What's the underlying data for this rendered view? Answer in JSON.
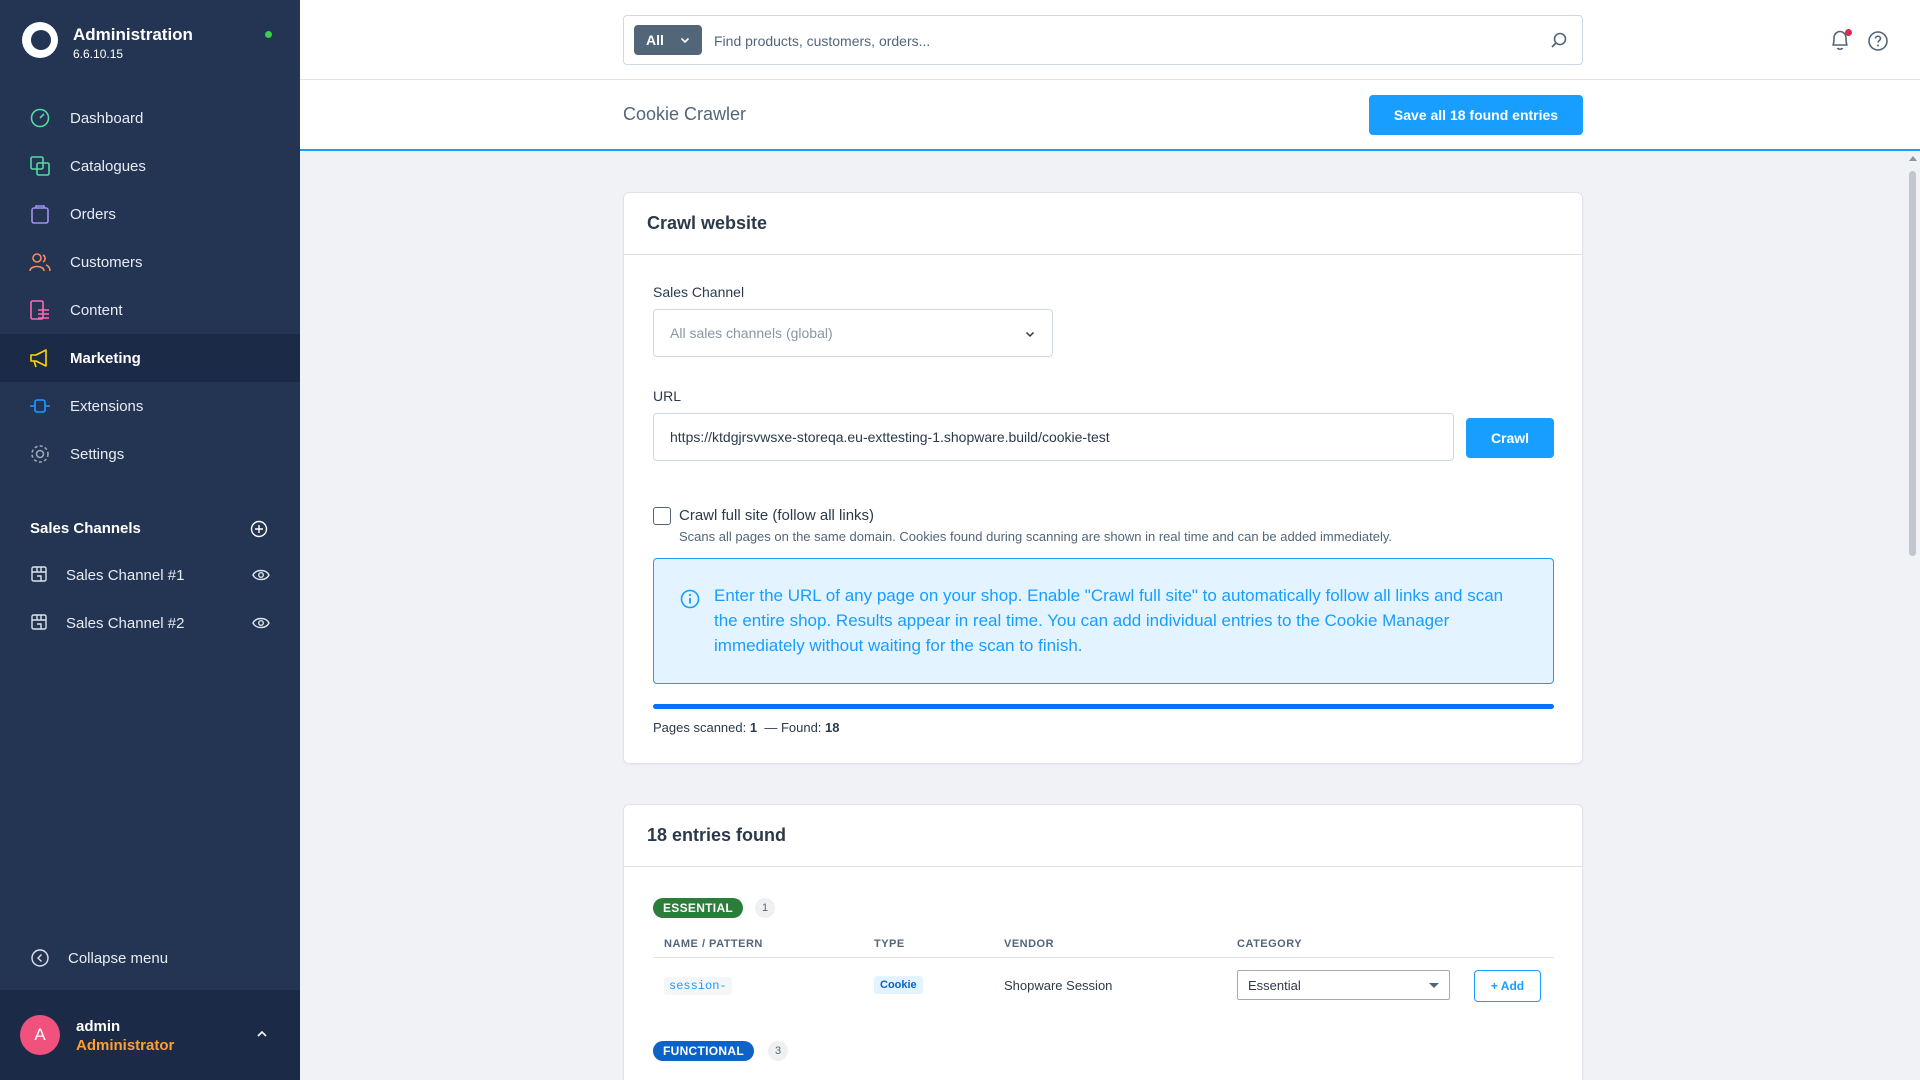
{
  "brand": {
    "title": "Administration",
    "version": "6.6.10.15"
  },
  "nav": [
    {
      "label": "Dashboard",
      "icon": "dashboard-icon",
      "color": "#57d9a3",
      "active": false
    },
    {
      "label": "Catalogues",
      "icon": "catalogues-icon",
      "color": "#57d9a3",
      "active": false
    },
    {
      "label": "Orders",
      "icon": "orders-icon",
      "color": "#a092f0",
      "active": false
    },
    {
      "label": "Customers",
      "icon": "customers-icon",
      "color": "#f88962",
      "active": false
    },
    {
      "label": "Content",
      "icon": "content-icon",
      "color": "#ff68b4",
      "active": false
    },
    {
      "label": "Marketing",
      "icon": "megaphone-icon",
      "color": "#ffd700",
      "active": true
    },
    {
      "label": "Extensions",
      "icon": "extensions-icon",
      "color": "#189eff",
      "active": false
    },
    {
      "label": "Settings",
      "icon": "settings-icon",
      "color": "#9aa8b5",
      "active": false
    }
  ],
  "sales_channels": {
    "heading": "Sales Channels",
    "items": [
      {
        "label": "Sales Channel #1"
      },
      {
        "label": "Sales Channel #2"
      }
    ]
  },
  "collapse_label": "Collapse menu",
  "user": {
    "initial": "A",
    "name": "admin",
    "role": "Administrator"
  },
  "search": {
    "type_label": "All",
    "placeholder": "Find products, customers, orders..."
  },
  "header": {
    "title": "Cookie Crawler",
    "save_label": "Save all 18 found entries"
  },
  "crawl": {
    "title": "Crawl website",
    "sales_channel_label": "Sales Channel",
    "sales_channel_value": "All sales channels (global)",
    "url_label": "URL",
    "url_value": "https://ktdgjrsvwsxe-storeqa.eu-exttesting-1.shopware.build/cookie-test",
    "crawl_label": "Crawl",
    "full_site_label": "Crawl full site (follow all links)",
    "full_site_help": "Scans all pages on the same domain. Cookies found during scanning are shown in real time and can be added immediately.",
    "full_site_checked": false,
    "info": "Enter the URL of any page on your shop. Enable \"Crawl full site\" to automatically follow all links and scan the entire shop. Results appear in real time. You can add individual entries to the Cookie Manager immediately without waiting for the scan to finish.",
    "progress_percent": 100,
    "pages_label": "Pages scanned:",
    "pages_value": "1",
    "found_label": "— Found:",
    "found_value": "18"
  },
  "entries": {
    "title": "18 entries found",
    "columns": [
      "NAME / PATTERN",
      "TYPE",
      "VENDOR",
      "CATEGORY"
    ],
    "groups": [
      {
        "label": "ESSENTIAL",
        "count": "1",
        "color": "#2a7e3a",
        "rows": [
          {
            "name": "session-",
            "type": "Cookie",
            "vendor": "Shopware Session",
            "category": "Essential",
            "add_label": "+ Add"
          }
        ]
      },
      {
        "label": "FUNCTIONAL",
        "count": "3",
        "color": "#0b63c8",
        "rows": []
      }
    ]
  }
}
